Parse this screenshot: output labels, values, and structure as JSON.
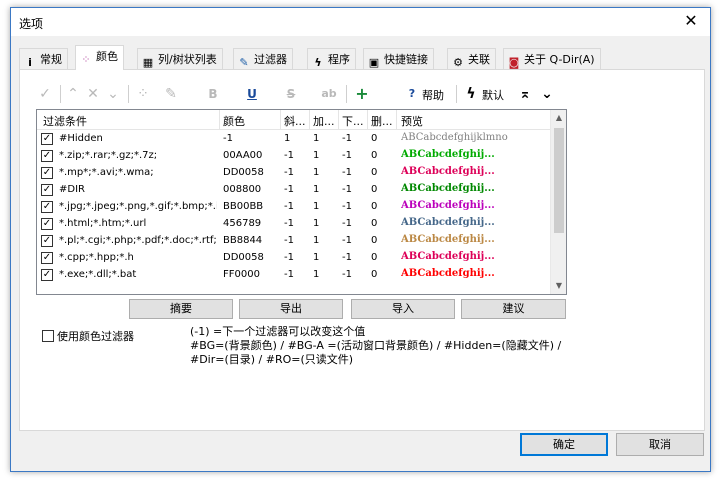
{
  "window": {
    "title": "选项",
    "close_glyph": "✕"
  },
  "tabs": [
    {
      "label": "常规",
      "icon": "info-icon",
      "glyph": "i"
    },
    {
      "label": "颜色",
      "icon": "palette-icon",
      "glyph": "⁘"
    },
    {
      "label": "列/树状列表",
      "icon": "grid-icon",
      "glyph": "▦"
    },
    {
      "label": "过滤器",
      "icon": "filter-edit-icon",
      "glyph": "✎"
    },
    {
      "label": "程序",
      "icon": "lightning-icon",
      "glyph": "ϟ"
    },
    {
      "label": "快捷链接",
      "icon": "link-board-icon",
      "glyph": "▣"
    },
    {
      "label": "关联",
      "icon": "association-icon",
      "glyph": "⚙"
    },
    {
      "label": "关于 Q-Dir(A)",
      "icon": "about-icon",
      "glyph": "◙"
    }
  ],
  "toolbar": {
    "check_glyph": "✓",
    "up_glyph": "⌃",
    "delete_glyph": "✕",
    "down_glyph": "⌄",
    "palette_glyph": "⁘",
    "pen_glyph": "✎",
    "bold_glyph": "B",
    "underline_glyph": "U",
    "strike_glyph": "S",
    "font_glyph": "ab",
    "add_glyph": "+",
    "help_glyph": "?",
    "help_label": "帮助",
    "default_glyph": "ϟ",
    "default_label": "默认",
    "move_top_glyph": "⌅",
    "move_bottom_glyph": "⌄"
  },
  "table": {
    "headers": [
      "过滤条件",
      "颜色",
      "斜...",
      "加...",
      "下...",
      "删...",
      "预览"
    ],
    "rows": [
      {
        "filter": "#Hidden",
        "color": "-1",
        "italic": "1",
        "bold": "1",
        "underline": "-1",
        "strike": "0",
        "preview": "ABCabcdefghijklmno",
        "preview_color": "#808080",
        "plain": true
      },
      {
        "filter": "*.zip;*.rar;*.gz;*.7z;",
        "color": "00AA00",
        "italic": "-1",
        "bold": "1",
        "underline": "-1",
        "strike": "0",
        "preview": "ABCabcdefghij...",
        "preview_color": "#00aa00",
        "plain": false
      },
      {
        "filter": "*.mp*;*.avi;*.wma;",
        "color": "DD0058",
        "italic": "-1",
        "bold": "1",
        "underline": "-1",
        "strike": "0",
        "preview": "ABCabcdefghij...",
        "preview_color": "#dd0058",
        "plain": false
      },
      {
        "filter": "#DIR",
        "color": "008800",
        "italic": "-1",
        "bold": "1",
        "underline": "-1",
        "strike": "0",
        "preview": "ABCabcdefghij...",
        "preview_color": "#008800",
        "plain": false
      },
      {
        "filter": "*.jpg;*.jpeg;*.png,*.gif;*.bmp;*.ico",
        "color": "BB00BB",
        "italic": "-1",
        "bold": "1",
        "underline": "-1",
        "strike": "0",
        "preview": "ABCabcdefghij...",
        "preview_color": "#bb00bb",
        "plain": false
      },
      {
        "filter": "*.html;*.htm;*.url",
        "color": "456789",
        "italic": "-1",
        "bold": "1",
        "underline": "-1",
        "strike": "0",
        "preview": "ABCabcdefghij...",
        "preview_color": "#456789",
        "plain": false
      },
      {
        "filter": "*.pl;*.cgi;*.php;*.pdf;*.doc;*.rtf;*...",
        "color": "BB8844",
        "italic": "-1",
        "bold": "1",
        "underline": "-1",
        "strike": "0",
        "preview": "ABCabcdefghij...",
        "preview_color": "#bb8844",
        "plain": false
      },
      {
        "filter": "*.cpp;*.hpp;*.h",
        "color": "DD0058",
        "italic": "-1",
        "bold": "1",
        "underline": "-1",
        "strike": "0",
        "preview": "ABCabcdefghij...",
        "preview_color": "#dd0058",
        "plain": false
      },
      {
        "filter": "*.exe;*.dll;*.bat",
        "color": "FF0000",
        "italic": "-1",
        "bold": "1",
        "underline": "-1",
        "strike": "0",
        "preview": "ABCabcdefghij...",
        "preview_color": "#ff0000",
        "plain": false
      }
    ]
  },
  "actions": {
    "summary": "摘要",
    "export": "导出",
    "import": "导入",
    "suggest": "建议"
  },
  "use_color_filter_label": "使用颜色过滤器",
  "hint_line1": "(-1) =下一个过滤器可以改变这个值",
  "hint_line2": "#BG=(背景颜色) / #BG-A =(活动窗口背景颜色) / #Hidden=(隐藏文件) / #Dir=(目录) / #RO=(只读文件)",
  "footer": {
    "ok": "确定",
    "cancel": "取消"
  },
  "colors": {
    "accent": "#0078d7",
    "window_border": "#3b78c4",
    "toolbar_green": "#1a8a3a",
    "toolbar_blue": "#1a4a9a"
  }
}
